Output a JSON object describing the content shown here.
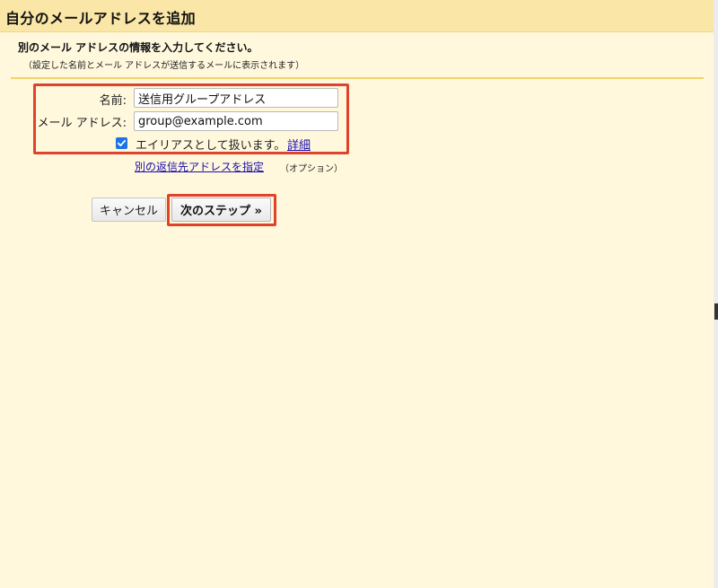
{
  "window": {
    "title": "自分のメールアドレスを追加"
  },
  "intro": {
    "heading": "別のメール アドレスの情報を入力してください。",
    "subheading": "（設定した名前とメール アドレスが送信するメールに表示されます）"
  },
  "form": {
    "name_label": "名前:",
    "name_value": "送信用グループアドレス",
    "email_label": "メール アドレス:",
    "email_value": "group@example.com",
    "alias_checked": true,
    "alias_label": "エイリアスとして扱います。",
    "details_link": "詳細",
    "reply_to_link": "別の返信先アドレスを指定",
    "optional_note": "（オプション）"
  },
  "buttons": {
    "cancel_label": "キャンセル",
    "next_label": "次のステップ »"
  },
  "colors": {
    "title_bar": "#fae7a8",
    "background": "#fff8dd",
    "divider": "#f1d26b",
    "highlight": "#e0432c",
    "checkbox": "#1a73e8",
    "link": "#1a0dab"
  },
  "icons": {
    "checkbox": "checkmark-icon"
  }
}
